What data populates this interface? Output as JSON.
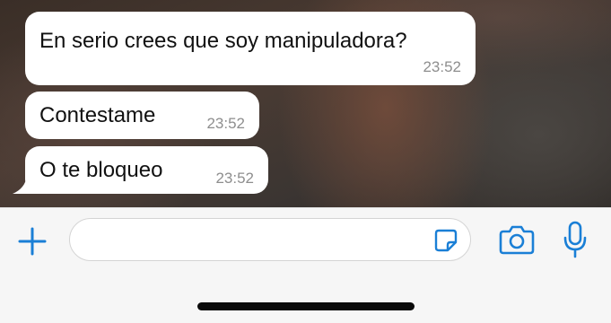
{
  "messages": [
    {
      "text": "En serio crees que soy manipuladora?",
      "time": "23:52"
    },
    {
      "text": "Contestame",
      "time": "23:52"
    },
    {
      "text": "O te bloqueo",
      "time": "23:52"
    }
  ],
  "composer": {
    "value": "",
    "plus_icon": "plus-icon",
    "sticker_icon": "sticker-icon",
    "camera_icon": "camera-icon",
    "mic_icon": "microphone-icon"
  },
  "colors": {
    "accent": "#1a7fd6",
    "bubble": "#ffffff",
    "timestamp": "#8e8e8e"
  }
}
